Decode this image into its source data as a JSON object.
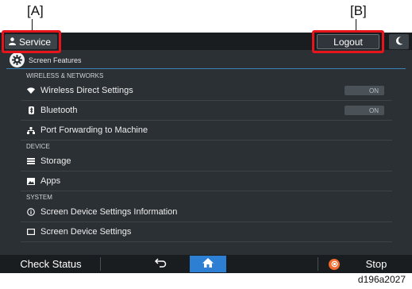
{
  "callouts": {
    "a": "[A]",
    "b": "[B]"
  },
  "header": {
    "user_label": "Service",
    "logout_label": "Logout"
  },
  "feature": {
    "title": "Screen Features"
  },
  "sections": {
    "wireless": "WIRELESS & NETWORKS",
    "device": "DEVICE",
    "system": "SYSTEM"
  },
  "items": {
    "wifi_direct": {
      "label": "Wireless Direct Settings",
      "toggle": "ON"
    },
    "bluetooth": {
      "label": "Bluetooth",
      "toggle": "ON"
    },
    "port_forwarding": {
      "label": "Port Forwarding to Machine"
    },
    "storage": {
      "label": "Storage"
    },
    "apps": {
      "label": "Apps"
    },
    "device_info": {
      "label": "Screen Device Settings Information"
    },
    "device_settings": {
      "label": "Screen Device Settings"
    }
  },
  "bottom": {
    "check_status": "Check Status",
    "stop": "Stop"
  },
  "figure_id": "d196a2027",
  "colors": {
    "highlight": "#e8141c",
    "home_accent": "#2d7fd3",
    "stop_accent": "#f26a2d"
  }
}
